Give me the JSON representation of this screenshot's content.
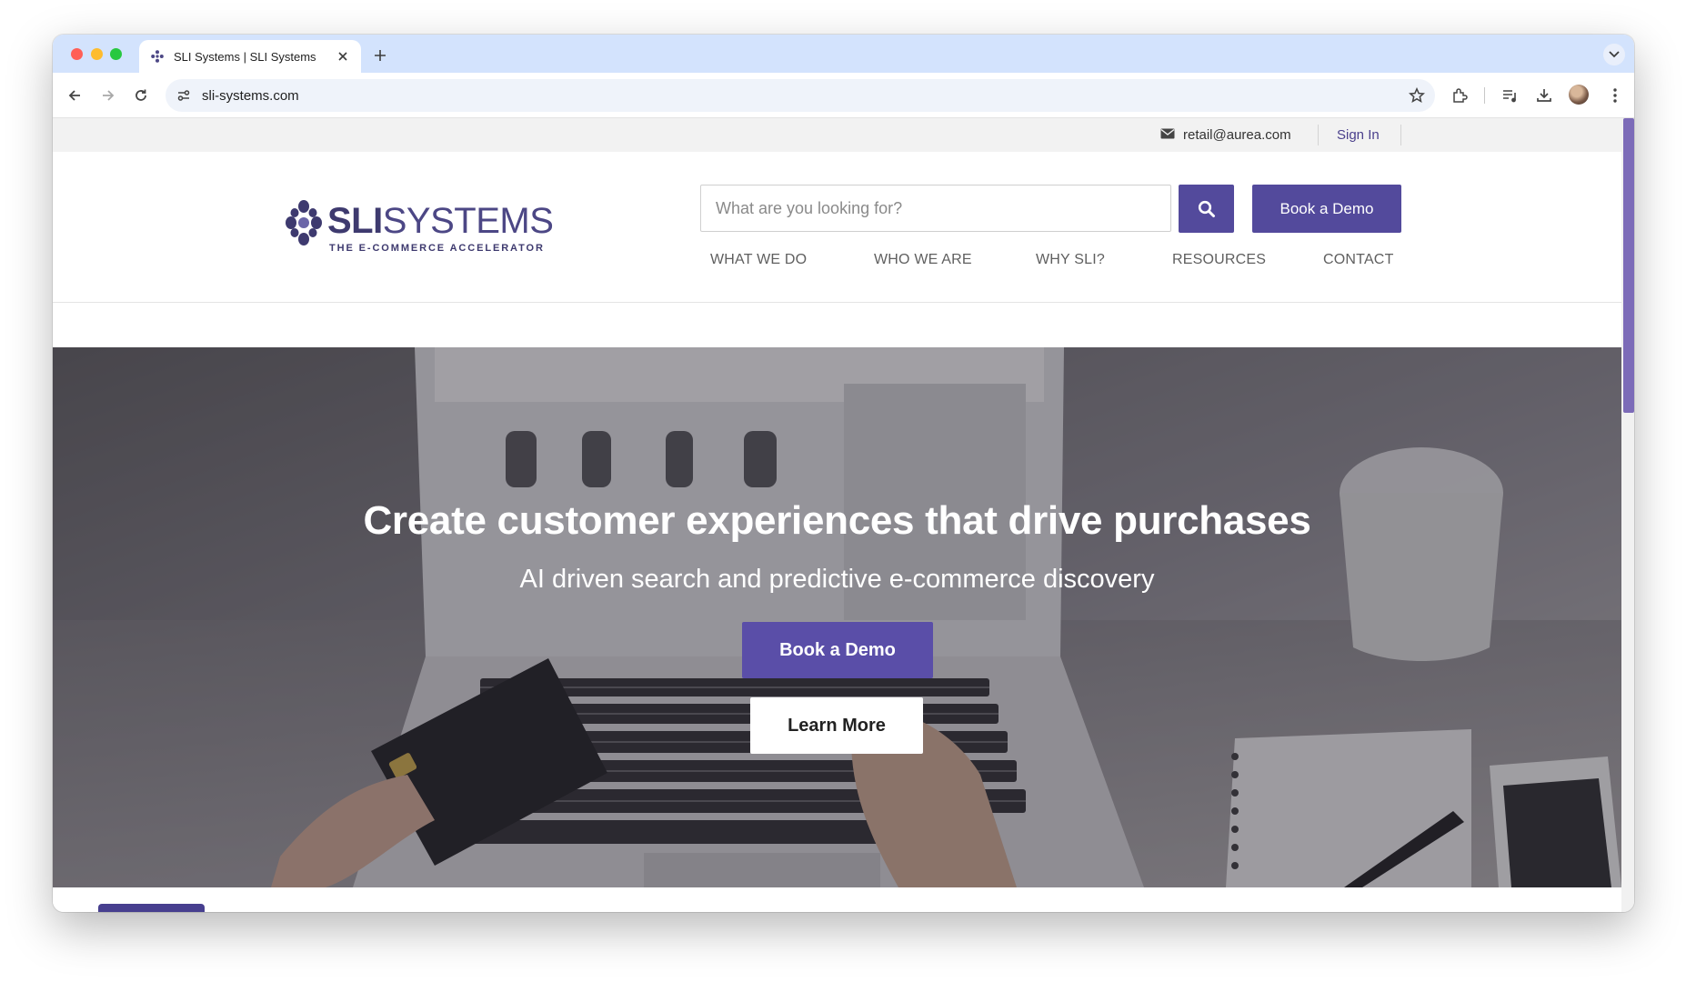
{
  "browser": {
    "tab_title": "SLI Systems | SLI Systems",
    "url": "sli-systems.com"
  },
  "utility_bar": {
    "email": "retail@aurea.com",
    "sign_in": "Sign In"
  },
  "header": {
    "logo": {
      "wordmark_bold": "SLI",
      "wordmark_light": "SYSTEMS",
      "tagline": "THE E-COMMERCE ACCELERATOR"
    },
    "search": {
      "placeholder": "What are you looking for?",
      "value": ""
    },
    "book_demo": "Book a Demo",
    "nav": [
      "WHAT WE DO",
      "WHO WE ARE",
      "WHY SLI?",
      "RESOURCES",
      "CONTACT"
    ]
  },
  "hero": {
    "title": "Create customer experiences that drive purchases",
    "subtitle": "AI driven search and predictive e-commerce discovery",
    "primary_cta": "Book a Demo",
    "secondary_cta": "Learn More"
  },
  "colors": {
    "brand_purple": "#534a9c",
    "scrollbar": "#7c6bb8",
    "tab_strip": "#d3e3fd"
  },
  "icons": {
    "email": "envelope-icon",
    "search": "magnifier-icon",
    "tab_close": "close-icon",
    "bookmark": "star-icon"
  }
}
